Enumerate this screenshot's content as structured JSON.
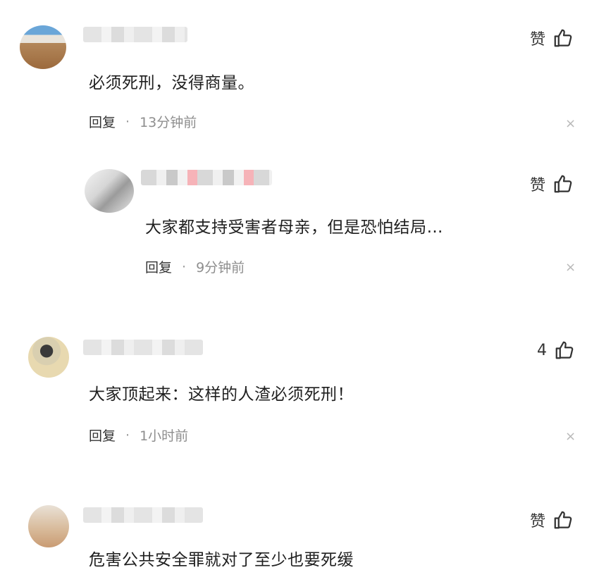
{
  "comments": [
    {
      "text": "必须死刑，没得商量。",
      "reply_label": "回复",
      "separator": "·",
      "time": "13分钟前",
      "like_label": "赞",
      "close_icon": "×"
    },
    {
      "text": "大家都支持受害者母亲，但是恐怕结局…",
      "reply_label": "回复",
      "separator": "·",
      "time": "9分钟前",
      "like_label": "赞",
      "close_icon": "×"
    },
    {
      "text": "大家顶起来：这样的人渣必须死刑！",
      "reply_label": "回复",
      "separator": "·",
      "time": "1小时前",
      "like_label": "4",
      "close_icon": "×"
    },
    {
      "text": "危害公共安全罪就对了至少也要死缓",
      "like_label": "赞"
    }
  ],
  "icons": {
    "like": "thumbs-up-icon",
    "close": "close-icon"
  }
}
